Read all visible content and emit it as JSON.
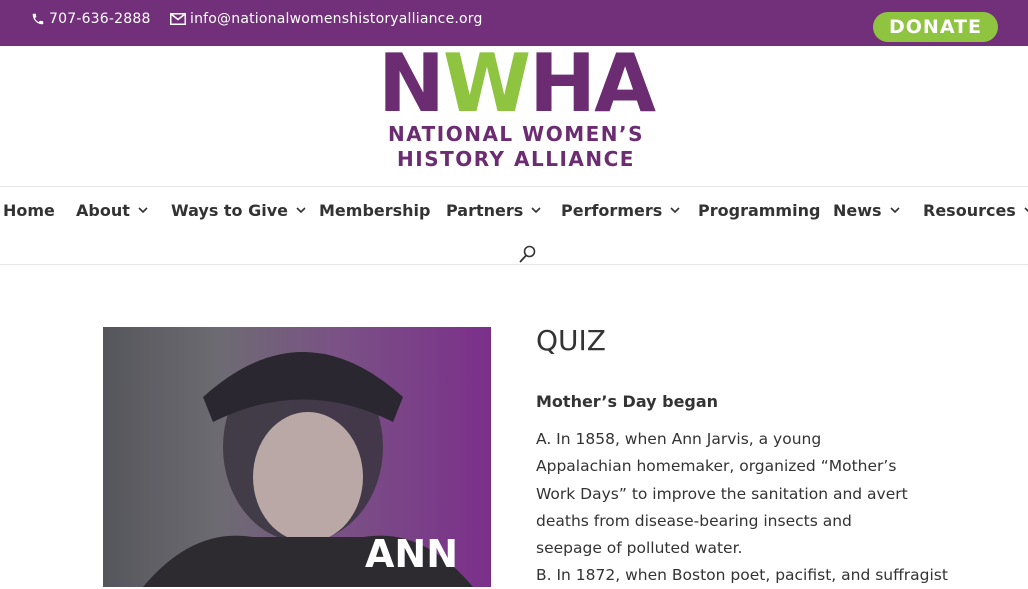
{
  "topbar": {
    "phone": "707-636-2888",
    "email": "info@nationalwomenshistoryalliance.org",
    "donate_label": "DONATE",
    "bg_color": "#72307a",
    "donate_color": "#8ec440"
  },
  "logo": {
    "letter_n": "N",
    "letter_w": "W",
    "letters_ha": "HA",
    "line1": "NATIONAL WOMEN’S",
    "line2": "HISTORY ALLIANCE"
  },
  "nav": {
    "items": [
      {
        "label": "Home",
        "has_caret": false
      },
      {
        "label": "About",
        "has_caret": true
      },
      {
        "label": "Ways to Give",
        "has_caret": true
      },
      {
        "label": "Membership",
        "has_caret": false
      },
      {
        "label": "Partners",
        "has_caret": true
      },
      {
        "label": "Performers",
        "has_caret": true
      },
      {
        "label": "Programming",
        "has_caret": false
      },
      {
        "label": "News",
        "has_caret": true
      },
      {
        "label": "Resources",
        "has_caret": true
      }
    ],
    "caret_glyph": "3"
  },
  "content": {
    "image_caption": "ANN",
    "title": "QUIZ",
    "question": "Mother’s Day began",
    "answer_a": "A. In 1858, when Ann Jarvis, a young Appalachian homemaker, organized “Mother’s Work Days” to improve the sanitation and avert deaths from disease-bearing insects and seepage of polluted water.",
    "answer_b_partial": "B. In 1872, when Boston poet, pacifist, and suffragist"
  }
}
